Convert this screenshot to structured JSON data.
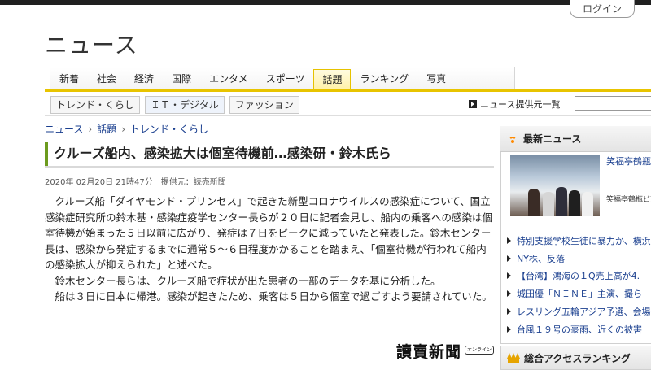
{
  "header": {
    "login_label": "ログイン",
    "site_title": "ニュース"
  },
  "main_nav": {
    "tabs": [
      {
        "label": "新着"
      },
      {
        "label": "社会"
      },
      {
        "label": "経済"
      },
      {
        "label": "国際"
      },
      {
        "label": "エンタメ"
      },
      {
        "label": "スポーツ"
      },
      {
        "label": "話題",
        "active": true
      },
      {
        "label": "ランキング"
      },
      {
        "label": "写真"
      }
    ]
  },
  "sub_nav": {
    "tabs": [
      {
        "label": "トレンド・くらし"
      },
      {
        "label": "ＩＴ・デジタル",
        "active": true
      },
      {
        "label": "ファッション"
      }
    ],
    "provider_link": "ニュース提供元一覧"
  },
  "breadcrumb": [
    "ニュース",
    "話題",
    "トレンド・くらし"
  ],
  "article": {
    "headline": "クルーズ船内、感染拡大は個室待機前…感染研・鈴木氏ら",
    "date": "2020年 02月20日 21時47分",
    "provider": "提供元：読売新聞",
    "paragraphs": [
      "クルーズ船「ダイヤモンド・プリンセス」で起きた新型コロナウイルスの感染症について、国立感染症研究所の鈴木基・感染症疫学センター長らが２０日に記者会見し、船内の乗客への感染は個室待機が始まった５日以前に広がり、発症は７日をピークに減っていたと発表した。鈴木センター長は、感染から発症するまでに通常５～６日程度かかることを踏まえ、「個室待機が行われて船内の感染拡大が抑えられた」と述べた。",
      "鈴木センター長らは、クルーズ船で症状が出た患者の一部のデータを基に分析した。",
      "船は３日に日本に帰港。感染が起きたため、乗客は５日から個室で過ごすよう要請されていた。"
    ],
    "paper_logo": "讀賣新聞",
    "online_badge": "オンライン"
  },
  "sidebar": {
    "latest_title": "最新ニュース",
    "feature": {
      "caption": "笑福亭鶴瓶、歴代校長を振り下げる",
      "sub": "笑福亭鶴瓶ビ東京系特別"
    },
    "items": [
      "特別支援学校生徒に暴力か、横浜",
      "NY株、反落",
      "【台湾】鴻海の１Q売上高が4.",
      "城田優「ＮＩＮＥ」主演、撮ら",
      "レスリング五輪アジア予選、会場",
      "台風１９号の豪雨、近くの被害"
    ],
    "ranking_title": "総合アクセスランキング"
  },
  "colors": {
    "accent_yellow": "#e8c400",
    "headline_bar": "#6c9b1e",
    "link_blue": "#1a3f8f"
  }
}
